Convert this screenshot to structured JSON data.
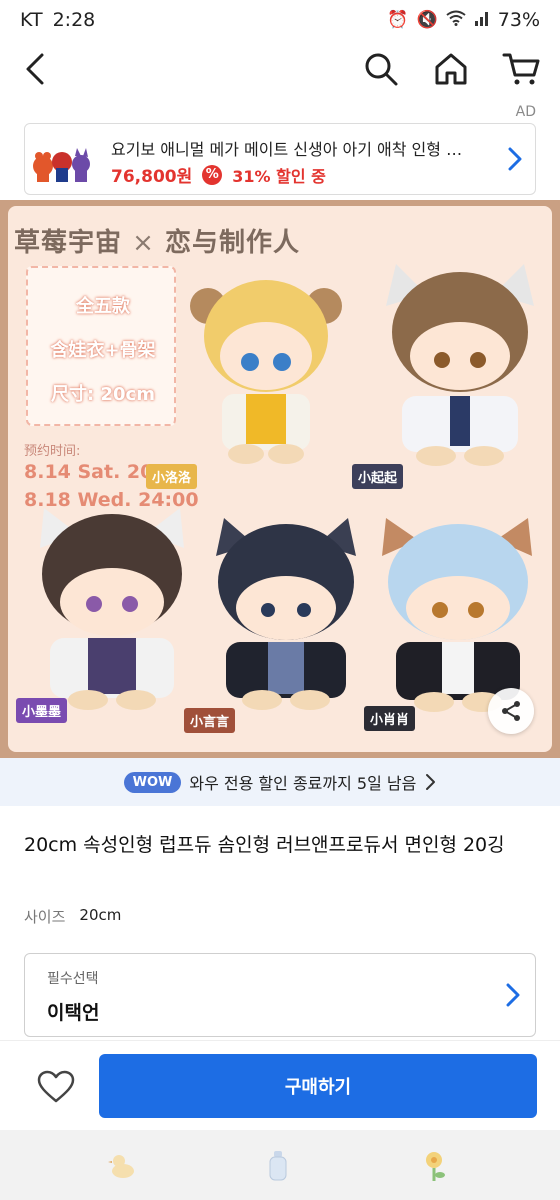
{
  "status_bar": {
    "carrier": "KT",
    "time": "2:28",
    "battery": "73%"
  },
  "ad": {
    "label": "AD",
    "title": "요기보 애니멀 메가 메이트 신생아 아기 애착 인형 …",
    "price": "76,800원",
    "pct_icon": "%",
    "discount": "31% 할인 중"
  },
  "product_image": {
    "brand": "草莓宇宙",
    "times": "×",
    "collab": "恋与制作人",
    "info_lines": [
      "全五款",
      "含娃衣+骨架",
      "尺寸: 20cm"
    ],
    "preorder_label": "预约时间:",
    "dates": [
      "8.14 Sat. 20:00",
      "8.18 Wed. 24:00"
    ],
    "dolls": [
      {
        "name": "小洛洛",
        "color": "#e8b64a"
      },
      {
        "name": "小起起",
        "color": "#3d3f5a"
      },
      {
        "name": "小墨墨",
        "color": "#7a4bb0"
      },
      {
        "name": "小言言",
        "color": "#a0503a"
      },
      {
        "name": "小肖肖",
        "color": "#2c2c34"
      }
    ]
  },
  "wow": {
    "badge": "WOW",
    "text": "와우 전용 할인 종료까지 5일 남음"
  },
  "product": {
    "title": "20cm 속성인형 럽프듀 솜인형 러브앤프로듀서 면인형 20깅",
    "size_label": "사이즈",
    "size_value": "20cm"
  },
  "option": {
    "label": "필수선택",
    "value": "이택언"
  },
  "buy_label": "구매하기",
  "colors": {
    "accent": "#1d6de4",
    "discount": "#e3342f",
    "wow": "#4a75d6"
  }
}
